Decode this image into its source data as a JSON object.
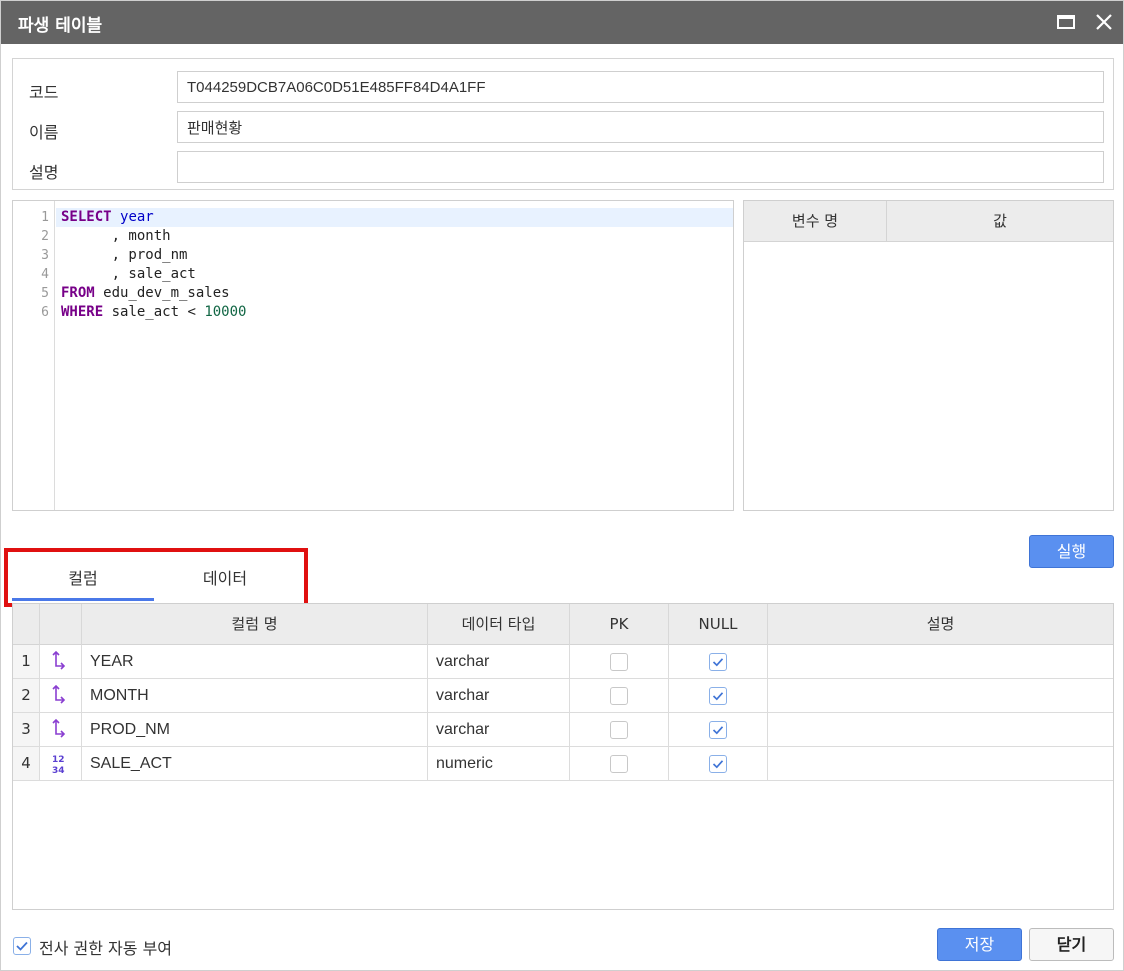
{
  "window": {
    "title": "파생 테이블",
    "maximize_icon": "maximize-icon",
    "close_icon": "close-icon"
  },
  "info": {
    "code_label": "코드",
    "code_value": "T044259DCB7A06C0D51E485FF84D4A1FF",
    "name_label": "이름",
    "name_value": "판매현황",
    "desc_label": "설명",
    "desc_value": ""
  },
  "editor": {
    "line_numbers": [
      "1",
      "2",
      "3",
      "4",
      "5",
      "6"
    ],
    "lines": [
      [
        {
          "t": "SELECT",
          "c": "kw"
        },
        {
          "t": " "
        },
        {
          "t": "year",
          "c": "vr"
        }
      ],
      [
        {
          "t": "      , month"
        }
      ],
      [
        {
          "t": "      , prod_nm"
        }
      ],
      [
        {
          "t": "      , sale_act"
        }
      ],
      [
        {
          "t": "FROM",
          "c": "kw"
        },
        {
          "t": " edu_dev_m_sales"
        }
      ],
      [
        {
          "t": "WHERE",
          "c": "kw"
        },
        {
          "t": " sale_act < "
        },
        {
          "t": "10000",
          "c": "nm"
        }
      ]
    ]
  },
  "variables": {
    "col_name": "변수 명",
    "col_value": "값"
  },
  "run_button": "실행",
  "tabs": {
    "columns": "컬럼",
    "data": "데이터",
    "active": "columns"
  },
  "grid": {
    "headers": {
      "name": "컬럼 명",
      "type": "데이터 타입",
      "pk": "PK",
      "null": "NULL",
      "desc": "설명"
    },
    "rows": [
      {
        "num": "1",
        "icon": "text-type-icon",
        "name": "YEAR",
        "type": "varchar",
        "pk": false,
        "null": true,
        "desc": ""
      },
      {
        "num": "2",
        "icon": "text-type-icon",
        "name": "MONTH",
        "type": "varchar",
        "pk": false,
        "null": true,
        "desc": ""
      },
      {
        "num": "3",
        "icon": "text-type-icon",
        "name": "PROD_NM",
        "type": "varchar",
        "pk": false,
        "null": true,
        "desc": ""
      },
      {
        "num": "4",
        "icon": "numeric-type-icon",
        "name": "SALE_ACT",
        "type": "numeric",
        "pk": false,
        "null": true,
        "desc": ""
      }
    ]
  },
  "footer": {
    "auto_grant_label": "전사 권한 자동 부여",
    "auto_grant_checked": true,
    "save": "저장",
    "close": "닫기"
  },
  "colors": {
    "titlebar": "#646464",
    "accent": "#5a90f0",
    "highlight": "#e01010",
    "tab_underline": "#4a78e8"
  }
}
